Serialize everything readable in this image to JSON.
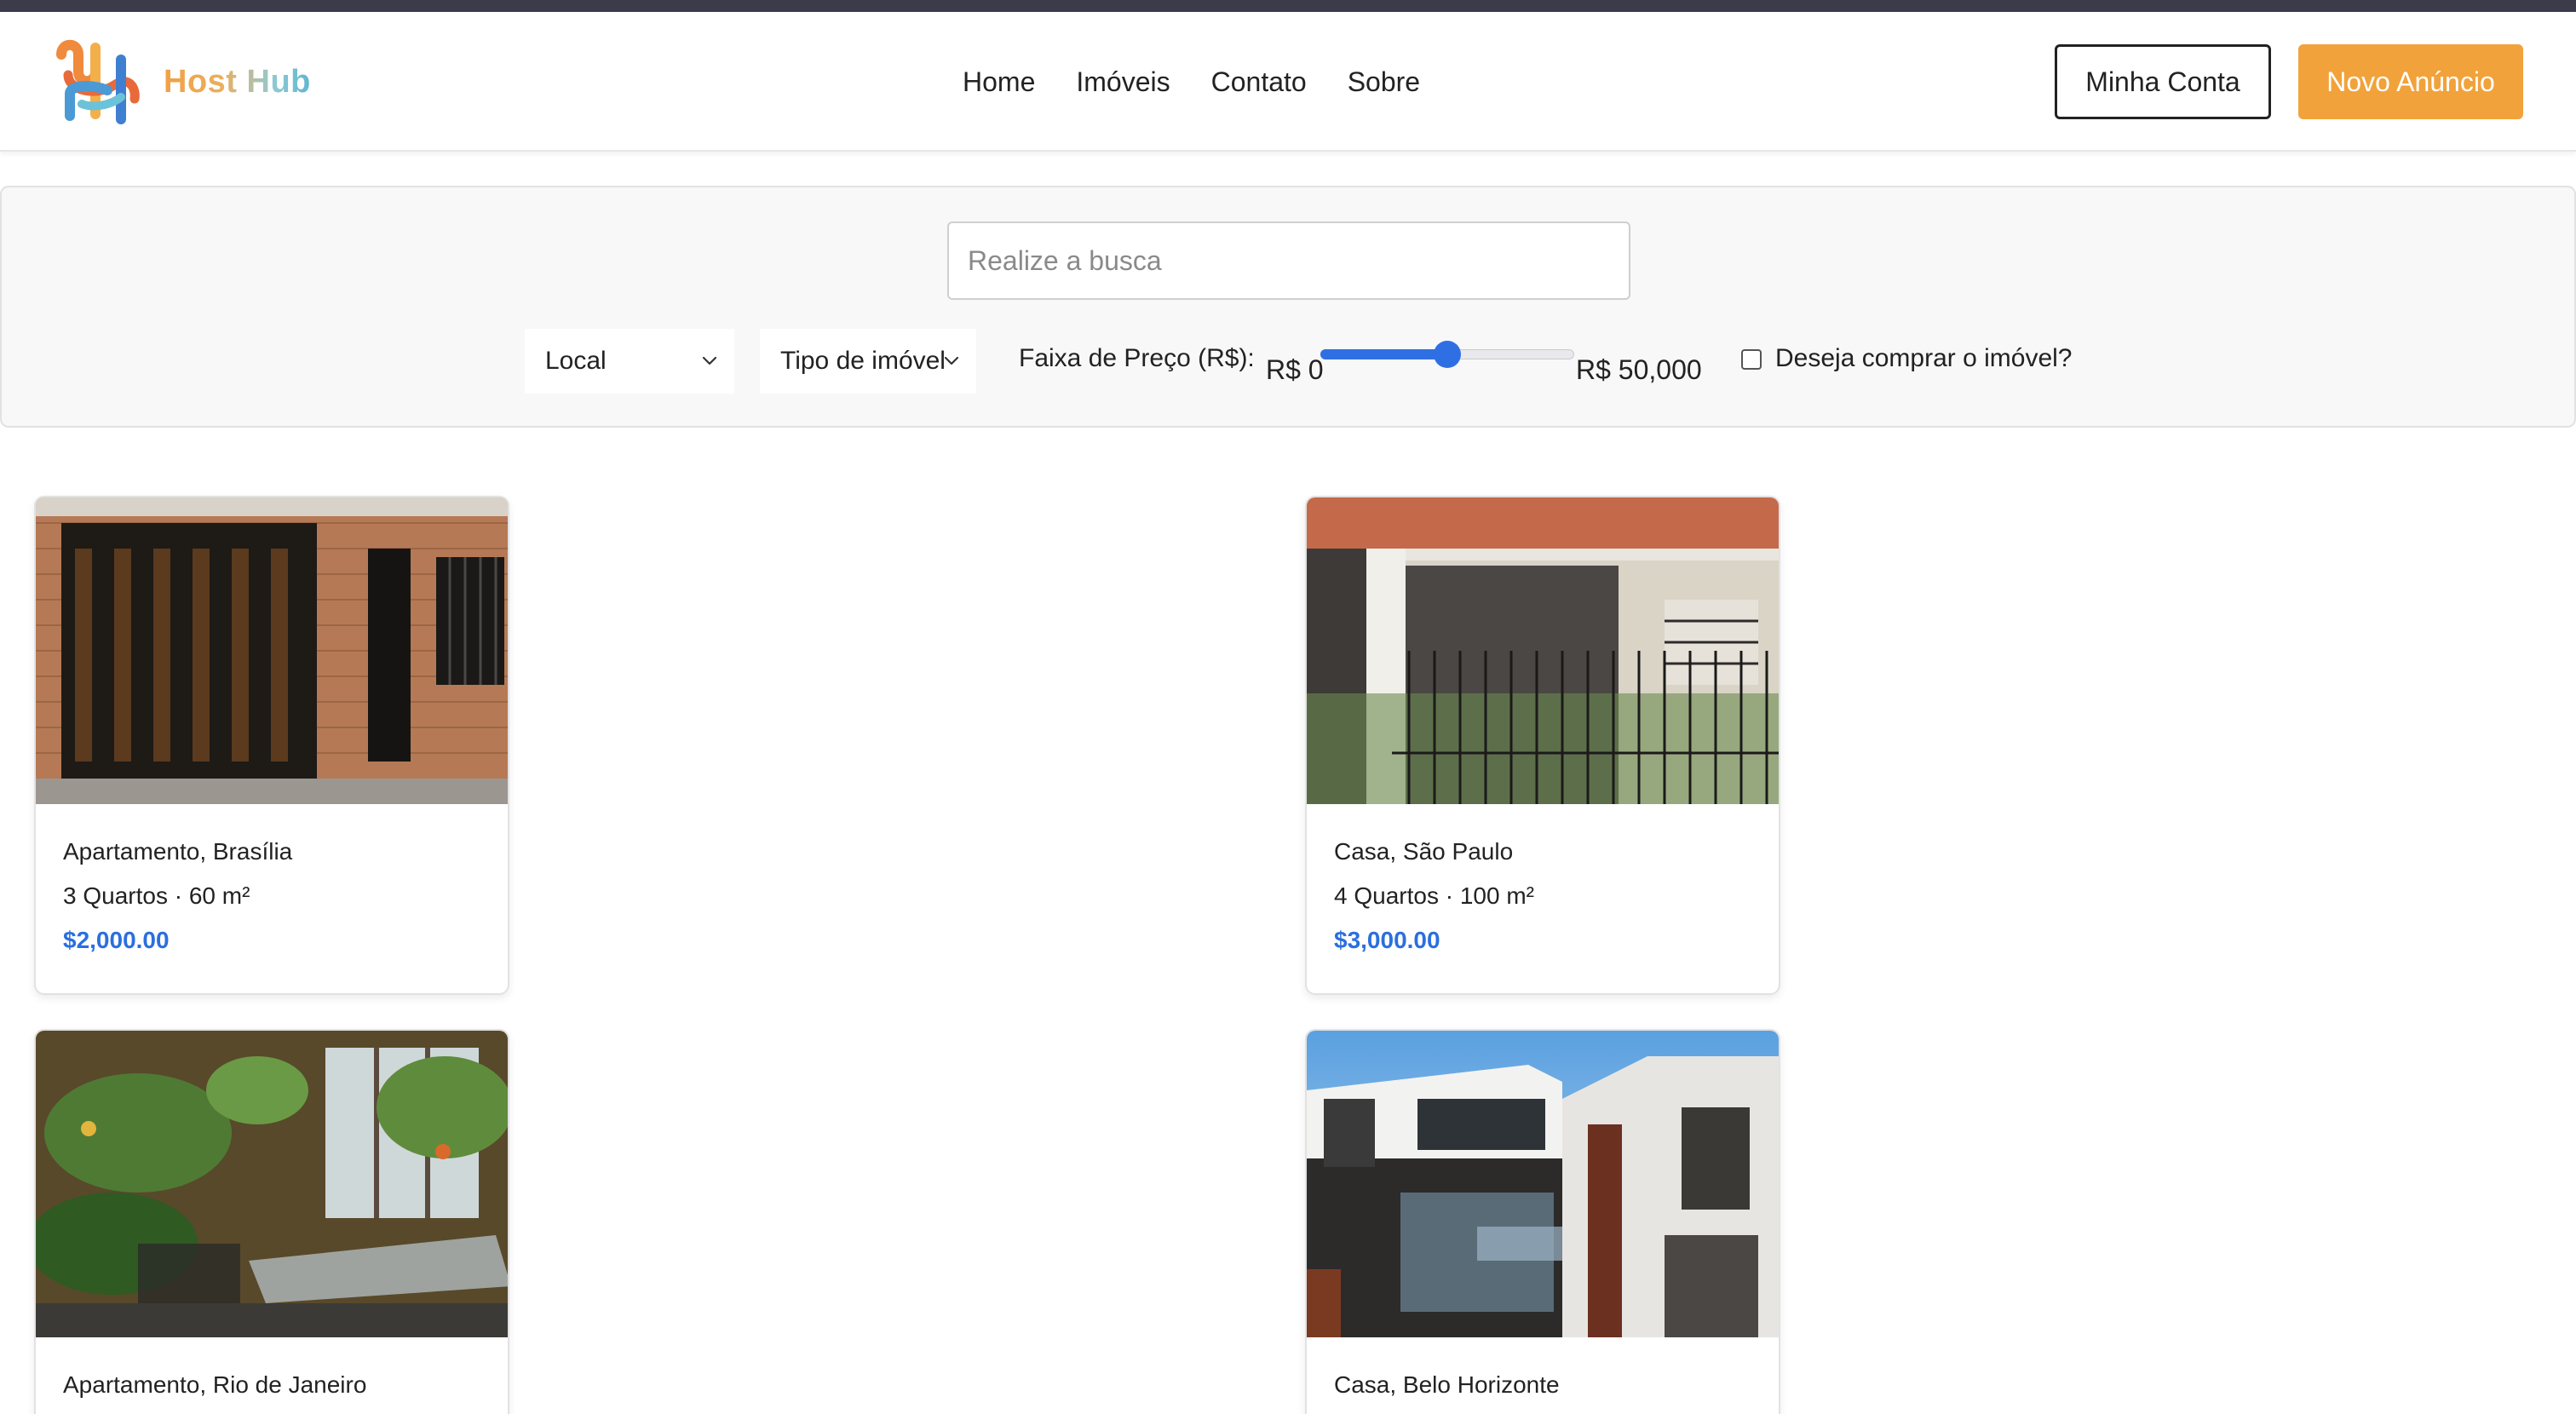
{
  "brand": {
    "name": "Host Hub",
    "logo_icon": "host-hub-logo-icon"
  },
  "nav": {
    "items": [
      {
        "label": "Home"
      },
      {
        "label": "Imóveis"
      },
      {
        "label": "Contato"
      },
      {
        "label": "Sobre"
      }
    ]
  },
  "header_actions": {
    "account_label": "Minha Conta",
    "new_listing_label": "Novo Anúncio"
  },
  "filters": {
    "search_placeholder": "Realize a busca",
    "location_select": "Local",
    "type_select": "Tipo de imóvel",
    "price_label": "Faixa de Preço (R$):",
    "price_min_label": "R$ 0",
    "price_max_label": "R$ 50,000",
    "price_slider_fraction": 0.5,
    "buy_checkbox_label": "Deseja comprar o imóvel?",
    "buy_checked": false
  },
  "listings": [
    {
      "title": "Apartamento, Brasília",
      "specs": "3 Quartos · 60 m²",
      "price": "$2,000.00"
    },
    {
      "title": "Casa, São Paulo",
      "specs": "4 Quartos · 100 m²",
      "price": "$3,000.00"
    },
    {
      "title": "Apartamento, Rio de Janeiro",
      "specs": "",
      "price": ""
    },
    {
      "title": "Casa, Belo Horizonte",
      "specs": "",
      "price": ""
    }
  ],
  "colors": {
    "accent_orange": "#f2a23a",
    "price_blue": "#2b6fde",
    "slider_blue": "#2f6fe4",
    "top_strip": "#3b3b4a"
  }
}
